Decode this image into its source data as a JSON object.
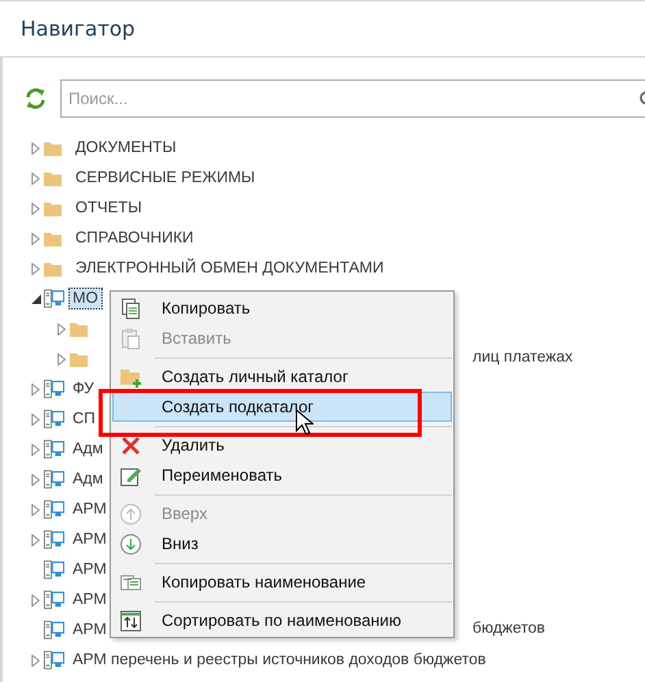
{
  "window": {
    "title": "Навигатор"
  },
  "search": {
    "placeholder": "Поиск..."
  },
  "tree": [
    {
      "label": "ДОКУМЕНТЫ",
      "kind": "folder",
      "has_children": true,
      "expanded": false,
      "selected": false
    },
    {
      "label": "СЕРВИСНЫЕ РЕЖИМЫ",
      "kind": "folder",
      "has_children": true,
      "expanded": false,
      "selected": false
    },
    {
      "label": "ОТЧЕТЫ",
      "kind": "folder",
      "has_children": true,
      "expanded": false,
      "selected": false
    },
    {
      "label": "СПРАВОЧНИКИ",
      "kind": "folder",
      "has_children": true,
      "expanded": false,
      "selected": false
    },
    {
      "label": "ЭЛЕКТРОННЫЙ ОБМЕН ДОКУМЕНТАМИ",
      "kind": "folder",
      "has_children": true,
      "expanded": false,
      "selected": false
    },
    {
      "label": "МО",
      "kind": "workstation",
      "has_children": true,
      "expanded": true,
      "selected": true,
      "children": [
        {
          "kind": "folder",
          "has_children": true,
          "expanded": false
        },
        {
          "tail": "лиц платежах",
          "kind": "folder",
          "has_children": true,
          "expanded": false
        }
      ]
    },
    {
      "label": "ФУ",
      "kind": "workstation",
      "has_children": true,
      "expanded": false,
      "selected": false
    },
    {
      "label": "СП",
      "kind": "workstation",
      "has_children": true,
      "expanded": false,
      "selected": false
    },
    {
      "label": "Адм",
      "kind": "workstation",
      "has_children": true,
      "expanded": false,
      "selected": false
    },
    {
      "label": "Адм",
      "kind": "workstation",
      "has_children": true,
      "expanded": false,
      "selected": false
    },
    {
      "label": "АРМ",
      "kind": "workstation",
      "has_children": true,
      "expanded": false,
      "selected": false
    },
    {
      "label": "АРМ",
      "kind": "workstation",
      "has_children": true,
      "expanded": false,
      "selected": false
    },
    {
      "label": "АРМ",
      "kind": "workstation",
      "has_children": false,
      "selected": false
    },
    {
      "label": "АРМ",
      "kind": "workstation",
      "has_children": true,
      "expanded": false,
      "selected": false
    },
    {
      "label": "АРМ",
      "tail": "бюджетов",
      "kind": "workstation",
      "has_children": false,
      "selected": false
    },
    {
      "label": "АРМ перечень и реестры источников доходов бюджетов",
      "kind": "workstation",
      "has_children": true,
      "expanded": false,
      "selected": false
    }
  ],
  "context_menu": [
    {
      "kind": "item",
      "label": "Копировать",
      "disabled": false,
      "selected": false
    },
    {
      "kind": "item",
      "label": "Вставить",
      "disabled": true,
      "selected": false
    },
    {
      "kind": "separator"
    },
    {
      "kind": "item",
      "label": "Создать личный каталог",
      "disabled": false,
      "selected": false
    },
    {
      "kind": "item",
      "label": "Создать подкаталог",
      "disabled": false,
      "selected": true
    },
    {
      "kind": "separator"
    },
    {
      "kind": "item",
      "label": "Удалить",
      "disabled": false,
      "selected": false
    },
    {
      "kind": "item",
      "label": "Переименовать",
      "disabled": false,
      "selected": false
    },
    {
      "kind": "separator"
    },
    {
      "kind": "item",
      "label": "Вверх",
      "disabled": true,
      "selected": false
    },
    {
      "kind": "item",
      "label": "Вниз",
      "disabled": false,
      "selected": false
    },
    {
      "kind": "separator"
    },
    {
      "kind": "item",
      "label": "Копировать наименование",
      "disabled": false,
      "selected": false
    },
    {
      "kind": "separator"
    },
    {
      "kind": "item",
      "label": "Сортировать по наименованию",
      "disabled": false,
      "selected": false
    }
  ]
}
